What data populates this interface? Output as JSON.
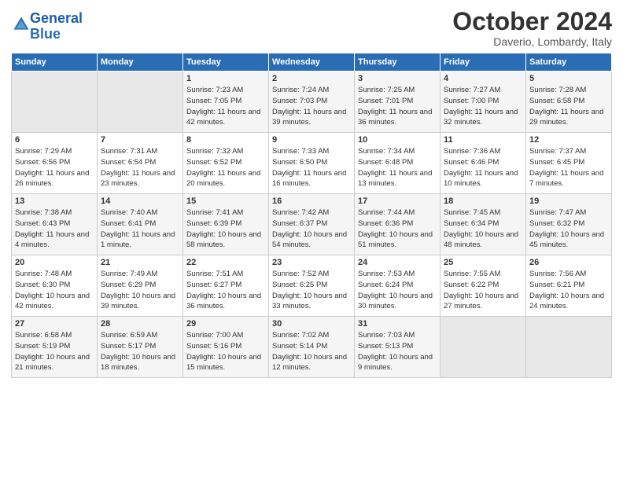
{
  "header": {
    "logo_line1": "General",
    "logo_line2": "Blue",
    "month": "October 2024",
    "location": "Daverio, Lombardy, Italy"
  },
  "days_of_week": [
    "Sunday",
    "Monday",
    "Tuesday",
    "Wednesday",
    "Thursday",
    "Friday",
    "Saturday"
  ],
  "weeks": [
    [
      {
        "day": "",
        "info": ""
      },
      {
        "day": "",
        "info": ""
      },
      {
        "day": "1",
        "info": "Sunrise: 7:23 AM\nSunset: 7:05 PM\nDaylight: 11 hours and 42 minutes."
      },
      {
        "day": "2",
        "info": "Sunrise: 7:24 AM\nSunset: 7:03 PM\nDaylight: 11 hours and 39 minutes."
      },
      {
        "day": "3",
        "info": "Sunrise: 7:25 AM\nSunset: 7:01 PM\nDaylight: 11 hours and 36 minutes."
      },
      {
        "day": "4",
        "info": "Sunrise: 7:27 AM\nSunset: 7:00 PM\nDaylight: 11 hours and 32 minutes."
      },
      {
        "day": "5",
        "info": "Sunrise: 7:28 AM\nSunset: 6:58 PM\nDaylight: 11 hours and 29 minutes."
      }
    ],
    [
      {
        "day": "6",
        "info": "Sunrise: 7:29 AM\nSunset: 6:56 PM\nDaylight: 11 hours and 26 minutes."
      },
      {
        "day": "7",
        "info": "Sunrise: 7:31 AM\nSunset: 6:54 PM\nDaylight: 11 hours and 23 minutes."
      },
      {
        "day": "8",
        "info": "Sunrise: 7:32 AM\nSunset: 6:52 PM\nDaylight: 11 hours and 20 minutes."
      },
      {
        "day": "9",
        "info": "Sunrise: 7:33 AM\nSunset: 6:50 PM\nDaylight: 11 hours and 16 minutes."
      },
      {
        "day": "10",
        "info": "Sunrise: 7:34 AM\nSunset: 6:48 PM\nDaylight: 11 hours and 13 minutes."
      },
      {
        "day": "11",
        "info": "Sunrise: 7:36 AM\nSunset: 6:46 PM\nDaylight: 11 hours and 10 minutes."
      },
      {
        "day": "12",
        "info": "Sunrise: 7:37 AM\nSunset: 6:45 PM\nDaylight: 11 hours and 7 minutes."
      }
    ],
    [
      {
        "day": "13",
        "info": "Sunrise: 7:38 AM\nSunset: 6:43 PM\nDaylight: 11 hours and 4 minutes."
      },
      {
        "day": "14",
        "info": "Sunrise: 7:40 AM\nSunset: 6:41 PM\nDaylight: 11 hours and 1 minute."
      },
      {
        "day": "15",
        "info": "Sunrise: 7:41 AM\nSunset: 6:39 PM\nDaylight: 10 hours and 58 minutes."
      },
      {
        "day": "16",
        "info": "Sunrise: 7:42 AM\nSunset: 6:37 PM\nDaylight: 10 hours and 54 minutes."
      },
      {
        "day": "17",
        "info": "Sunrise: 7:44 AM\nSunset: 6:36 PM\nDaylight: 10 hours and 51 minutes."
      },
      {
        "day": "18",
        "info": "Sunrise: 7:45 AM\nSunset: 6:34 PM\nDaylight: 10 hours and 48 minutes."
      },
      {
        "day": "19",
        "info": "Sunrise: 7:47 AM\nSunset: 6:32 PM\nDaylight: 10 hours and 45 minutes."
      }
    ],
    [
      {
        "day": "20",
        "info": "Sunrise: 7:48 AM\nSunset: 6:30 PM\nDaylight: 10 hours and 42 minutes."
      },
      {
        "day": "21",
        "info": "Sunrise: 7:49 AM\nSunset: 6:29 PM\nDaylight: 10 hours and 39 minutes."
      },
      {
        "day": "22",
        "info": "Sunrise: 7:51 AM\nSunset: 6:27 PM\nDaylight: 10 hours and 36 minutes."
      },
      {
        "day": "23",
        "info": "Sunrise: 7:52 AM\nSunset: 6:25 PM\nDaylight: 10 hours and 33 minutes."
      },
      {
        "day": "24",
        "info": "Sunrise: 7:53 AM\nSunset: 6:24 PM\nDaylight: 10 hours and 30 minutes."
      },
      {
        "day": "25",
        "info": "Sunrise: 7:55 AM\nSunset: 6:22 PM\nDaylight: 10 hours and 27 minutes."
      },
      {
        "day": "26",
        "info": "Sunrise: 7:56 AM\nSunset: 6:21 PM\nDaylight: 10 hours and 24 minutes."
      }
    ],
    [
      {
        "day": "27",
        "info": "Sunrise: 6:58 AM\nSunset: 5:19 PM\nDaylight: 10 hours and 21 minutes."
      },
      {
        "day": "28",
        "info": "Sunrise: 6:59 AM\nSunset: 5:17 PM\nDaylight: 10 hours and 18 minutes."
      },
      {
        "day": "29",
        "info": "Sunrise: 7:00 AM\nSunset: 5:16 PM\nDaylight: 10 hours and 15 minutes."
      },
      {
        "day": "30",
        "info": "Sunrise: 7:02 AM\nSunset: 5:14 PM\nDaylight: 10 hours and 12 minutes."
      },
      {
        "day": "31",
        "info": "Sunrise: 7:03 AM\nSunset: 5:13 PM\nDaylight: 10 hours and 9 minutes."
      },
      {
        "day": "",
        "info": ""
      },
      {
        "day": "",
        "info": ""
      }
    ]
  ]
}
